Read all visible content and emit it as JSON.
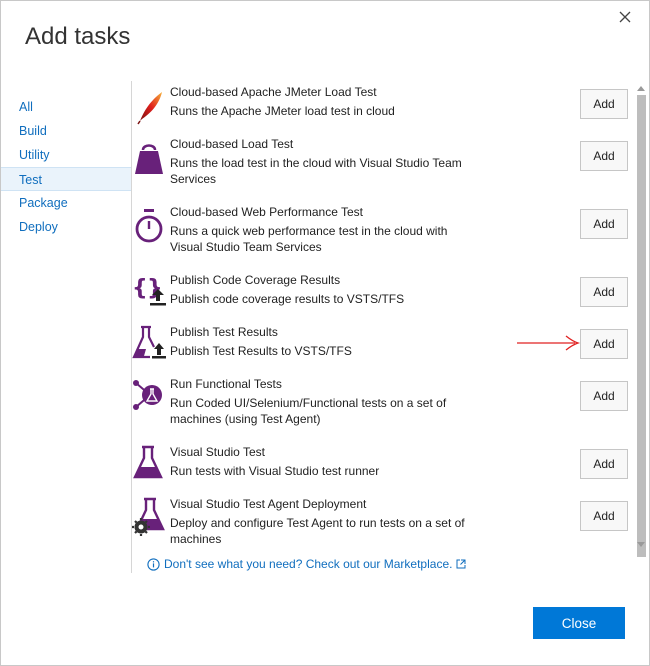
{
  "dialog": {
    "title": "Add tasks",
    "close_button_label": "Close"
  },
  "nav": {
    "items": [
      {
        "label": "All",
        "selected": false
      },
      {
        "label": "Build",
        "selected": false
      },
      {
        "label": "Utility",
        "selected": false
      },
      {
        "label": "Test",
        "selected": true
      },
      {
        "label": "Package",
        "selected": false
      },
      {
        "label": "Deploy",
        "selected": false
      }
    ]
  },
  "tasks": [
    {
      "name": "Cloud-based Apache JMeter Load Test",
      "description": "Runs the Apache JMeter load test in cloud",
      "add_label": "Add",
      "icon": "jmeter-feather-icon"
    },
    {
      "name": "Cloud-based Load Test",
      "description": "Runs the load test in the cloud with Visual Studio Team Services",
      "add_label": "Add",
      "icon": "weight-icon"
    },
    {
      "name": "Cloud-based Web Performance Test",
      "description": "Runs a quick web performance test in the cloud with Visual Studio Team Services",
      "add_label": "Add",
      "icon": "stopwatch-icon"
    },
    {
      "name": "Publish Code Coverage Results",
      "description": "Publish code coverage results to VSTS/TFS",
      "add_label": "Add",
      "icon": "code-coverage-upload-icon"
    },
    {
      "name": "Publish Test Results",
      "description": "Publish Test Results to VSTS/TFS",
      "add_label": "Add",
      "icon": "flask-upload-icon"
    },
    {
      "name": "Run Functional Tests",
      "description": "Run Coded UI/Selenium/Functional tests on a set of machines (using Test Agent)",
      "add_label": "Add",
      "icon": "functional-test-icon"
    },
    {
      "name": "Visual Studio Test",
      "description": "Run tests with Visual Studio test runner",
      "add_label": "Add",
      "icon": "flask-icon"
    },
    {
      "name": "Visual Studio Test Agent Deployment",
      "description": "Deploy and configure Test Agent to run tests on a set of machines",
      "add_label": "Add",
      "icon": "flask-gear-icon"
    }
  ],
  "marketplace": {
    "text": "Don't see what you need? Check out our Marketplace."
  },
  "colors": {
    "accent": "#0078d7",
    "link": "#106ebe",
    "icon_purple": "#68217a",
    "annotation_red": "#e02020"
  }
}
